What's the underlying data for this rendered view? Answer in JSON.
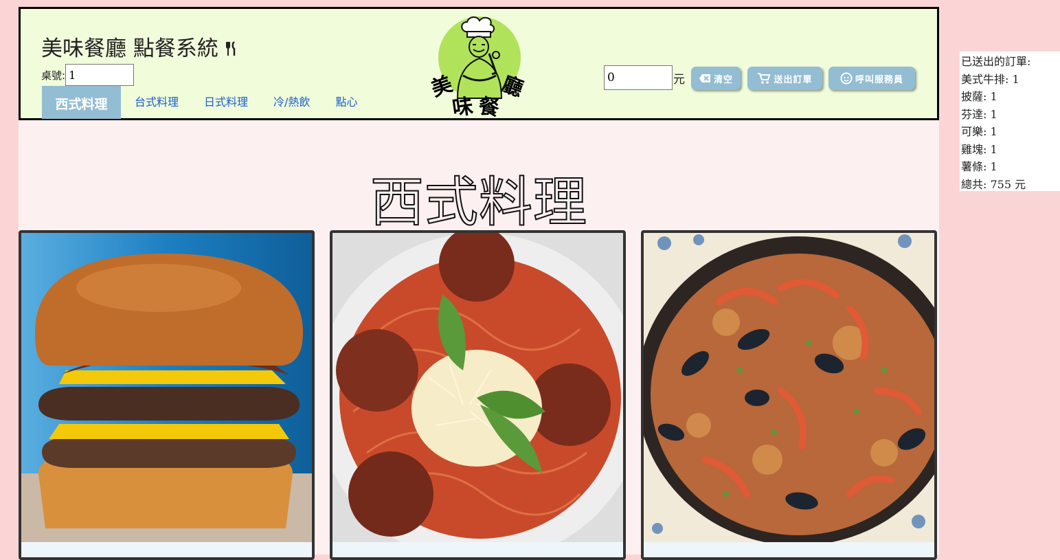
{
  "header": {
    "title": "美味餐廳 點餐系統",
    "table_label": "桌號:",
    "table_value": "1",
    "logo_text": [
      "美",
      "味",
      "餐",
      "廳"
    ],
    "tabs": [
      {
        "label": "西式料理",
        "active": true
      },
      {
        "label": "台式料理",
        "active": false
      },
      {
        "label": "日式料理",
        "active": false
      },
      {
        "label": "冷/熱飲",
        "active": false
      },
      {
        "label": "點心",
        "active": false
      }
    ],
    "total_value": "0",
    "total_unit": "元",
    "buttons": {
      "clear": "清空",
      "submit": "送出訂單",
      "call": "呼叫服務員"
    }
  },
  "section": {
    "title": "西式料理"
  },
  "sent_orders": {
    "title": "已送出的訂單:",
    "items": [
      "美式牛排: 1",
      "披薩: 1",
      "芬達: 1",
      "可樂: 1",
      "雞塊: 1",
      "薯條: 1"
    ],
    "total": "總共: 755 元"
  },
  "colors": {
    "page_bg": "#fbd5d5",
    "main_bg": "#fdf0f0",
    "header_bg": "#f1fcdb",
    "accent": "#93bdd3",
    "tab_link": "#1a5fc9",
    "logo_circle": "#b0e35a"
  }
}
